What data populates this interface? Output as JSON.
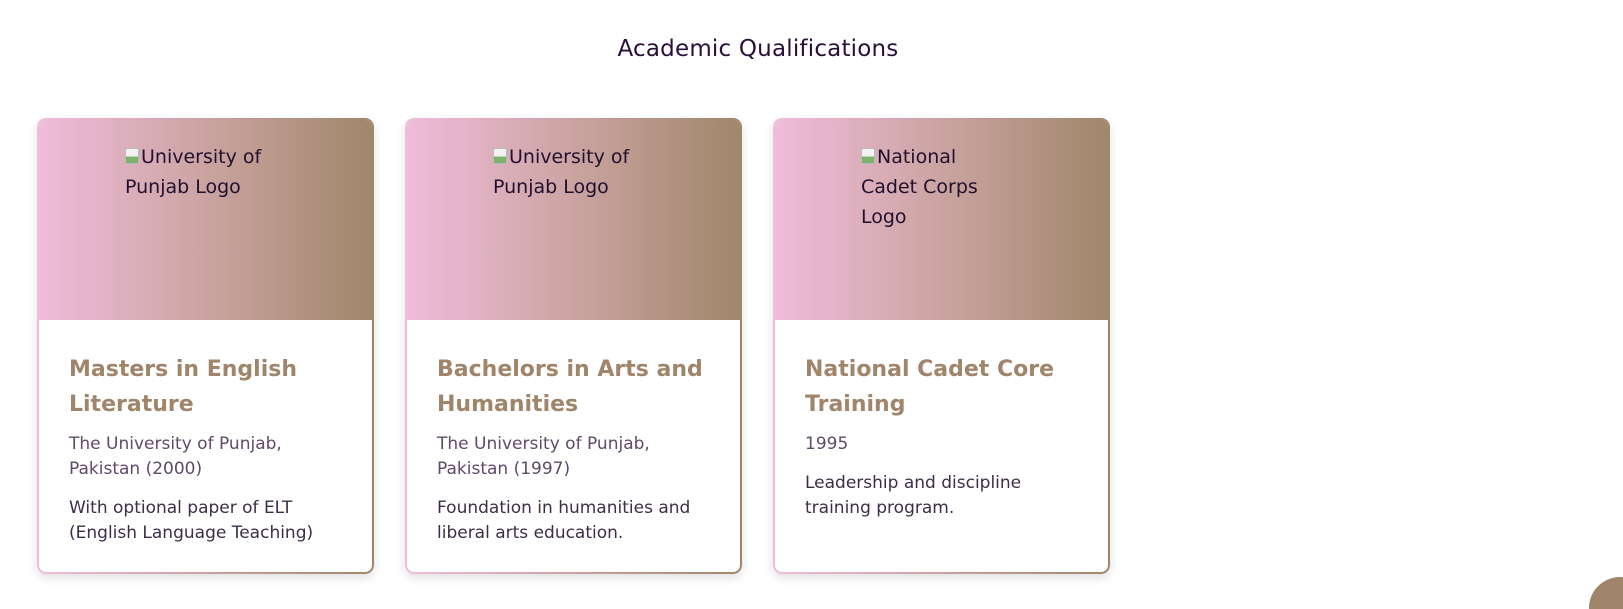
{
  "section": {
    "title": "Academic Qualifications"
  },
  "cards": [
    {
      "logo_alt": "University of Punjab Logo",
      "title": "Masters in English Literature",
      "institution": "The University of Punjab, Pakistan (2000)",
      "description": "With optional paper of ELT (English Language Teaching)"
    },
    {
      "logo_alt": "University of Punjab Logo",
      "title": "Bachelors in Arts and Humanities",
      "institution": "The University of Punjab, Pakistan (1997)",
      "description": "Foundation in humanities and liberal arts education."
    },
    {
      "logo_alt": "National Cadet Corps Logo",
      "title": "National Cadet Core Training",
      "institution": "1995",
      "description": "Leadership and discipline training program."
    }
  ],
  "colors": {
    "gradient_start": "#f0bcdc",
    "gradient_end": "#a0876a",
    "title_accent": "#a0856a",
    "heading_text": "#2a0f3a"
  },
  "icons": {
    "broken_image": "broken-image-icon",
    "scroll_top": "scroll-to-top-button"
  }
}
